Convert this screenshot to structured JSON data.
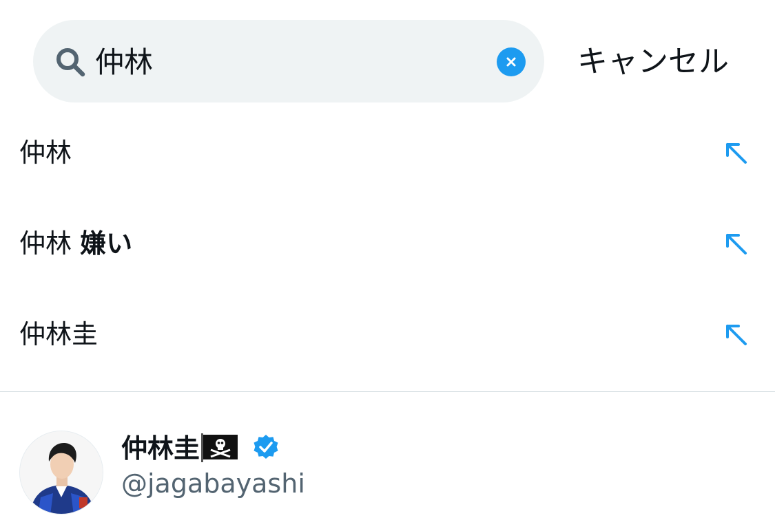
{
  "search": {
    "query": "仲林",
    "cancel_label": "キャンセル"
  },
  "suggestions": [
    {
      "text": "仲林",
      "bold_suffix": ""
    },
    {
      "text": "仲林 ",
      "bold_suffix": "嫌い"
    },
    {
      "text": "仲林圭",
      "bold_suffix": ""
    }
  ],
  "user_result": {
    "display_name": "仲林圭",
    "handle": "@jagabayashi",
    "verified": true,
    "flag_icon": "pirate-flag-icon"
  },
  "colors": {
    "accent": "#1d9bf0",
    "search_bg": "#eff3f4",
    "secondary_text": "#536471"
  }
}
